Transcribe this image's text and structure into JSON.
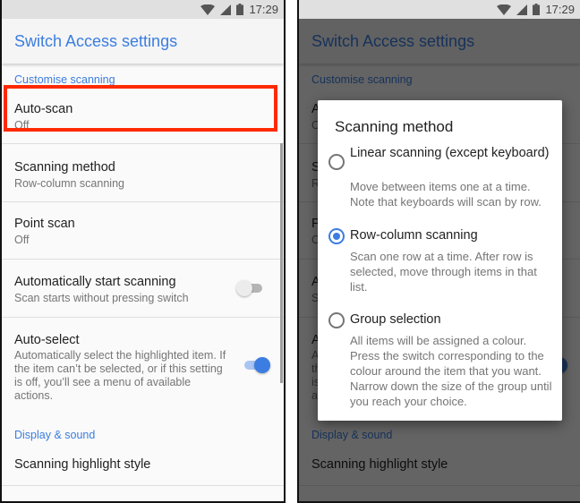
{
  "status_bar": {
    "time": "17:29",
    "icons": [
      "wifi-icon",
      "cellular-signal-icon",
      "battery-icon"
    ]
  },
  "app_bar": {
    "title": "Switch Access settings"
  },
  "settings": {
    "section_customise": "Customise scanning",
    "auto_scan": {
      "title": "Auto-scan",
      "summary": "Off"
    },
    "scanning_method": {
      "title": "Scanning method",
      "summary": "Row-column scanning"
    },
    "point_scan": {
      "title": "Point scan",
      "summary": "Off"
    },
    "auto_start": {
      "title": "Automatically start scanning",
      "summary": "Scan starts without pressing switch",
      "enabled": false
    },
    "auto_select": {
      "title": "Auto-select",
      "summary": "Automatically select the highlighted item. If the item can’t be selected, or if this setting is off, you’ll see a menu of available actions.",
      "enabled": true
    },
    "section_display": "Display & sound",
    "highlight_style": {
      "title": "Scanning highlight style"
    }
  },
  "colors": {
    "accent": "#3b7de0",
    "highlight_box": "#ff2a00"
  },
  "dialog": {
    "title": "Scanning method",
    "selected": "Row-column scanning",
    "options": [
      {
        "label": "Linear scanning (except keyboard)",
        "description": "Move between items one at a time. Note that keyboards will scan by row.",
        "checked": false
      },
      {
        "label": "Row-column scanning",
        "description": "Scan one row at a time. After row is selected, move through items in that list.",
        "checked": true
      },
      {
        "label": "Group selection",
        "description": "All items will be assigned a colour. Press the switch corresponding to the colour around the item that you want. Narrow down the size of the group until you reach your choice.",
        "checked": false
      }
    ]
  }
}
